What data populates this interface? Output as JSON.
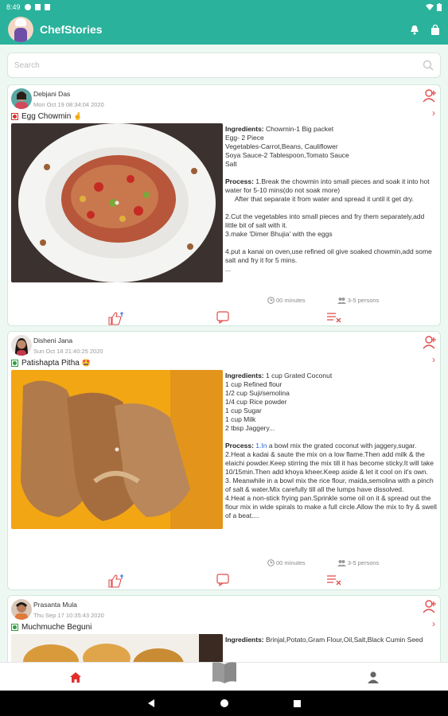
{
  "status_bar": {
    "time": "8:49"
  },
  "app": {
    "title": "ChefStories"
  },
  "search": {
    "placeholder": "Search",
    "value": ""
  },
  "labels": {
    "ingredients": "Ingredients:",
    "process": "Process:",
    "cook_time": "00 minutes",
    "serves": "3-5 persons"
  },
  "posts": [
    {
      "author": "Debjani Das",
      "date": "Mon Oct 19 08:34:04 2020",
      "veg": false,
      "title": "Egg Chowmin",
      "title_emoji": "🤞",
      "ingredients_first": "Chowmin-1 Big packet",
      "ingredients_lines": [
        "Egg- 2 Piece",
        "Vegetables-Carrot,Beans, Cauliflower",
        "Soya Sauce-2 Tablespoon,Tomato Sauce",
        "Salt"
      ],
      "process_first": "1.Break the chowmin into small pieces and soak it into hot water for 5-10 mins(do not soak more)",
      "process_lines": [
        "     After that separate it from water and spread it until it get dry.",
        "",
        "2.Cut the vegetables into small pieces and fry them separately,add little bit of salt with it.",
        "3.make 'Dimer Bhujia' with the eggs",
        "",
        "4.put a kanai on oven,use refined oil give soaked chowmin,add some salt and fry it for 5 mins.",
        "..."
      ]
    },
    {
      "author": "Disheni Jana",
      "date": "Sun Oct 18 21:40:25 2020",
      "veg": true,
      "title": "Patishapta Pitha",
      "title_emoji": "🤩",
      "ingredients_first": "1 cup Grated Coconut",
      "ingredients_lines": [
        "1 cup Refined flour",
        "1/2 cup Suji/semolina",
        "1/4 cup Rice powder",
        "1 cup Sugar",
        "1 cup Milk",
        "2 tbsp Jaggery..."
      ],
      "process_link": "1.In",
      "process_first": " a bowl mix the grated coconut with jaggery,sugar.",
      "process_lines": [
        "2.Heat a kadai & saute the mix on a low flame.Then add milk & the elaichi powder.Keep stirring the mix till it has become sticky.It will take 10/15min.Then add khoya kheer.Keep aside & let it cool on it's own.",
        "3. Meanwhile in a bowl mix the rice flour, maida,semolina with a pinch of salt & water.Mix carefully till all the lumps have dissolved.",
        "4.Heat a non-stick frying pan.Sprinkle some oil on it & spread out the flour mix in wide spirals to make a full circle.Allow the mix to fry & swell of a beat...."
      ]
    },
    {
      "author": "Prasanta Mula",
      "date": "Thu Sep 17 10:35:43 2020",
      "veg": true,
      "title": "Muchmuche Beguni",
      "ingredients_first": "Brinjal,Potato,Gram Flour,Oil,Salt,Black Cumin Seed"
    }
  ],
  "colors": {
    "primary": "#2ab29c",
    "accent_red": "#e24b4b",
    "veg_green": "#2e9e3e",
    "nonveg_red": "#d6322e"
  },
  "icons": {
    "like": "thumbs-up-icon",
    "comment": "comment-icon",
    "report": "report-icon",
    "follow": "add-user-icon",
    "home": "home-icon",
    "book": "book-icon",
    "profile": "person-icon"
  }
}
